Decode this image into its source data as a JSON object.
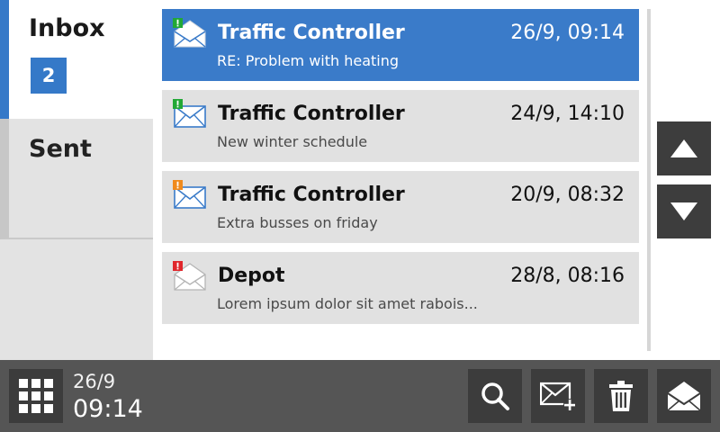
{
  "sidebar": {
    "inbox": {
      "label": "Inbox",
      "unread_count": "2"
    },
    "sent": {
      "label": "Sent"
    }
  },
  "messages": [
    {
      "sender": "Traffic Controller",
      "subject": "RE: Problem with heating",
      "timestamp": "26/9, 09:14",
      "priority": "normal",
      "priority_color": "#22a836",
      "state": "read",
      "selected": true
    },
    {
      "sender": "Traffic Controller",
      "subject": "New winter schedule",
      "timestamp": "24/9, 14:10",
      "priority": "normal",
      "priority_color": "#22a836",
      "state": "unread",
      "selected": false
    },
    {
      "sender": "Traffic Controller",
      "subject": "Extra busses on friday",
      "timestamp": "20/9, 08:32",
      "priority": "medium",
      "priority_color": "#f08a1c",
      "state": "unread",
      "selected": false
    },
    {
      "sender": "Depot",
      "subject": "Lorem ipsum dolor sit amet rabois...",
      "timestamp": "28/8, 08:16",
      "priority": "high",
      "priority_color": "#e0262b",
      "state": "read",
      "selected": false
    }
  ],
  "scroll": {
    "up_icon": "triangle-up-icon",
    "down_icon": "triangle-down-icon"
  },
  "statusbar": {
    "date": "26/9",
    "time": "09:14",
    "menu_icon": "grid-menu-icon",
    "actions": [
      "search-icon",
      "new-message-icon",
      "trash-icon",
      "open-envelope-icon"
    ]
  },
  "colors": {
    "accent": "#3a7bc9",
    "list_item_bg": "#e1e1e1",
    "sidebar_bg": "#e3e3e3",
    "bottom_bar_bg": "#555555",
    "button_bg": "#3c3c3c"
  }
}
